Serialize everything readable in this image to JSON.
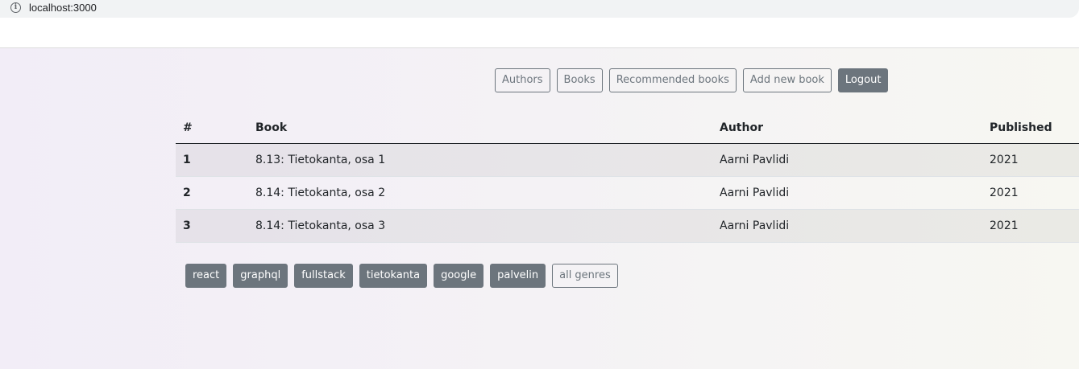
{
  "browser": {
    "url": "localhost:3000",
    "info_icon": "info-icon"
  },
  "nav": {
    "authors": "Authors",
    "books": "Books",
    "recommended": "Recommended books",
    "add_book": "Add new book",
    "logout": "Logout"
  },
  "table": {
    "headers": [
      "#",
      "Book",
      "Author",
      "Published"
    ],
    "rows": [
      {
        "num": "1",
        "title": "8.13: Tietokanta, osa 1",
        "author": "Aarni Pavlidi",
        "published": "2021"
      },
      {
        "num": "2",
        "title": "8.14: Tietokanta, osa 2",
        "author": "Aarni Pavlidi",
        "published": "2021"
      },
      {
        "num": "3",
        "title": "8.14: Tietokanta, osa 3",
        "author": "Aarni Pavlidi",
        "published": "2021"
      }
    ]
  },
  "genres": [
    "react",
    "graphql",
    "fullstack",
    "tietokanta",
    "google",
    "palvelin"
  ],
  "all_genres": "all genres",
  "colors": {
    "secondary": "#6c757d",
    "text": "#212529"
  }
}
